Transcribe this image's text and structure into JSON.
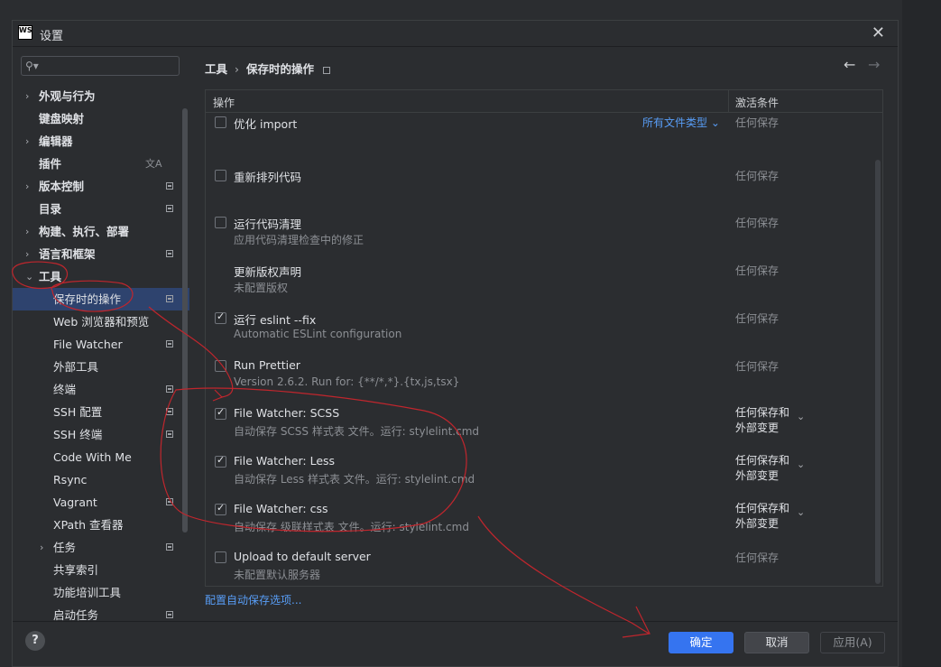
{
  "window": {
    "title": "设置",
    "app_logo": "WS"
  },
  "sidebar": {
    "search_placeholder": "",
    "items": [
      {
        "label": "外观与行为",
        "arrow": "›",
        "bold": true
      },
      {
        "label": "键盘映射",
        "bold": true
      },
      {
        "label": "编辑器",
        "arrow": "›",
        "bold": true
      },
      {
        "label": "插件",
        "bold": true,
        "translate": "文A"
      },
      {
        "label": "版本控制",
        "arrow": "›",
        "bold": true
      },
      {
        "label": "目录",
        "bold": true
      },
      {
        "label": "构建、执行、部署",
        "arrow": "›",
        "bold": true
      },
      {
        "label": "语言和框架",
        "arrow": "›",
        "bold": true
      },
      {
        "label": "工具",
        "arrow": "⌄",
        "bold": true
      },
      {
        "label": "保存时的操作",
        "selected": true
      },
      {
        "label": "Web 浏览器和预览"
      },
      {
        "label": "File Watcher"
      },
      {
        "label": "外部工具"
      },
      {
        "label": "终端"
      },
      {
        "label": "SSH 配置"
      },
      {
        "label": "SSH 终端"
      },
      {
        "label": "Code With Me"
      },
      {
        "label": "Rsync"
      },
      {
        "label": "Vagrant"
      },
      {
        "label": "XPath 查看器"
      },
      {
        "label": "任务",
        "arrow": "›"
      },
      {
        "label": "共享索引"
      },
      {
        "label": "功能培训工具"
      },
      {
        "label": "启动任务"
      }
    ]
  },
  "breadcrumb": {
    "parent": "工具",
    "current": "保存时的操作",
    "separator": "›"
  },
  "nav": {
    "back": "←",
    "forward": "→"
  },
  "table": {
    "col_ops": "操作",
    "col_cond": "激活条件",
    "rows": [
      {
        "title": "优化 import",
        "desc": "",
        "checked": false,
        "cond": "任何保存",
        "filetype": "所有文件类型 ⌄"
      },
      {
        "title": "重新排列代码",
        "desc": "",
        "checked": false,
        "cond": "任何保存"
      },
      {
        "title": "运行代码清理",
        "desc": "应用代码清理检查中的修正",
        "checked": false,
        "cond": "任何保存"
      },
      {
        "title": "更新版权声明",
        "desc": "未配置版权",
        "checked": null,
        "cond": "任何保存"
      },
      {
        "title": "运行 eslint --fix",
        "desc": "Automatic ESLint configuration",
        "checked": true,
        "cond": "任何保存"
      },
      {
        "title": "Run Prettier",
        "desc": "Version 2.6.2. Run for: {**/*,*}.{tx,js,tsx}",
        "checked": false,
        "cond": "任何保存"
      },
      {
        "title": "File Watcher: SCSS",
        "desc": "自动保存 SCSS 样式表 文件。运行: stylelint.cmd",
        "checked": true,
        "cond1": "任何保存和",
        "cond2": "外部变更"
      },
      {
        "title": "File Watcher: Less",
        "desc": "自动保存 Less 样式表 文件。运行: stylelint.cmd",
        "checked": true,
        "cond1": "任何保存和",
        "cond2": "外部变更"
      },
      {
        "title": "File Watcher: css",
        "desc": "自动保存 级联样式表 文件。运行: stylelint.cmd",
        "checked": true,
        "cond1": "任何保存和",
        "cond2": "外部变更"
      },
      {
        "title": "Upload to default server",
        "desc": "未配置默认服务器",
        "checked": false,
        "cond": "任何保存"
      }
    ]
  },
  "config_link": "配置自动保存选项...",
  "buttons": {
    "ok": "确定",
    "cancel": "取消",
    "apply": "应用(A)",
    "help": "?"
  },
  "icons": {
    "close": "close-icon",
    "search": "search-icon",
    "help": "help-icon"
  },
  "colors": {
    "accent": "#3574f0",
    "link": "#589df6",
    "selection": "#2e436e",
    "annotation": "#c0262d"
  }
}
